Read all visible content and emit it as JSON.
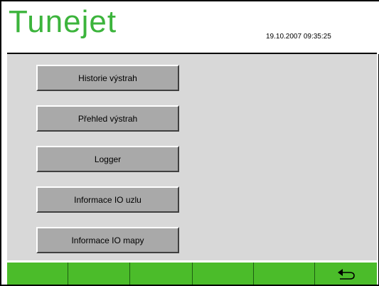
{
  "header": {
    "title": "Tunejet",
    "timestamp": "19.10.2007 09:35:25",
    "title_color": "#3cb43c"
  },
  "menu": {
    "buttons": [
      {
        "label": "Historie výstrah"
      },
      {
        "label": "Přehled výstrah"
      },
      {
        "label": "Logger"
      },
      {
        "label": "Informace IO uzlu"
      },
      {
        "label": "Informace IO mapy"
      }
    ]
  },
  "footer": {
    "color": "#4bbc2a",
    "keys": [
      {
        "label": "",
        "icon": ""
      },
      {
        "label": "",
        "icon": ""
      },
      {
        "label": "",
        "icon": ""
      },
      {
        "label": "",
        "icon": ""
      },
      {
        "label": "",
        "icon": ""
      },
      {
        "label": "",
        "icon": "return-arrow-icon"
      }
    ]
  }
}
